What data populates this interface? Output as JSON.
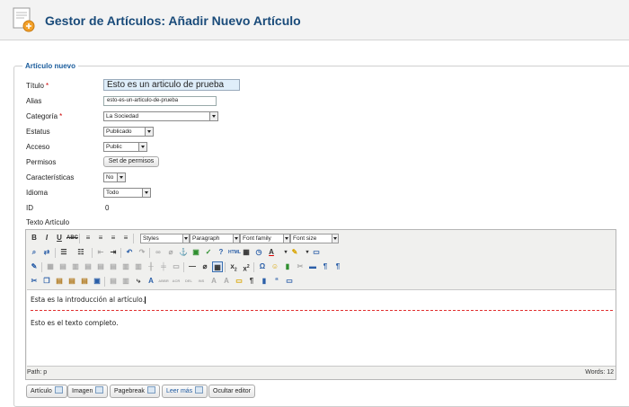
{
  "header": {
    "title": "Gestor de Artículos: Añadir Nuevo Artículo"
  },
  "form": {
    "legend": "Artículo nuevo",
    "titulo": {
      "label": "Título",
      "value": "Esto es un articulo de prueba"
    },
    "alias": {
      "label": "Alias",
      "value": "esto-es-un-articulo-de-prueba"
    },
    "categoria": {
      "label": "Categoría",
      "value": "La Sociedad"
    },
    "estatus": {
      "label": "Estatus",
      "value": "Publicado"
    },
    "acceso": {
      "label": "Acceso",
      "value": "Public"
    },
    "permisos": {
      "label": "Permisos",
      "button": "Set de permisos"
    },
    "caracteristicas": {
      "label": "Características",
      "value": "No"
    },
    "idioma": {
      "label": "Idioma",
      "value": "Todo"
    },
    "id": {
      "label": "ID",
      "value": "0"
    },
    "texto_label": "Texto Artículo"
  },
  "editor": {
    "selects": {
      "styles": "Styles",
      "paragraph": "Paragraph",
      "font_family": "Font family",
      "font_size": "Font size"
    },
    "glyphs": {
      "bold": "B",
      "italic": "I",
      "underline": "U",
      "strike": "ABC",
      "html": "HTML",
      "omega": "Ω",
      "quote": "“",
      "hr": "—"
    },
    "intro_text": "Esta es la introducción al artículo.",
    "full_text": "Esto es el texto completo.",
    "path": "Path: p",
    "words": "Words: 12"
  },
  "buttons": {
    "articulo": "Artículo",
    "imagen": "Imagen",
    "pagebreak": "Pagebreak",
    "leer_mas": "Leer más",
    "ocultar_editor": "Ocultar editor"
  },
  "colors": {
    "title": "#1a4b7a",
    "legend": "#1a5c9c",
    "required": "#cc0000",
    "readmore_line": "#e03030",
    "title_input_bg": "#dfeefa"
  }
}
